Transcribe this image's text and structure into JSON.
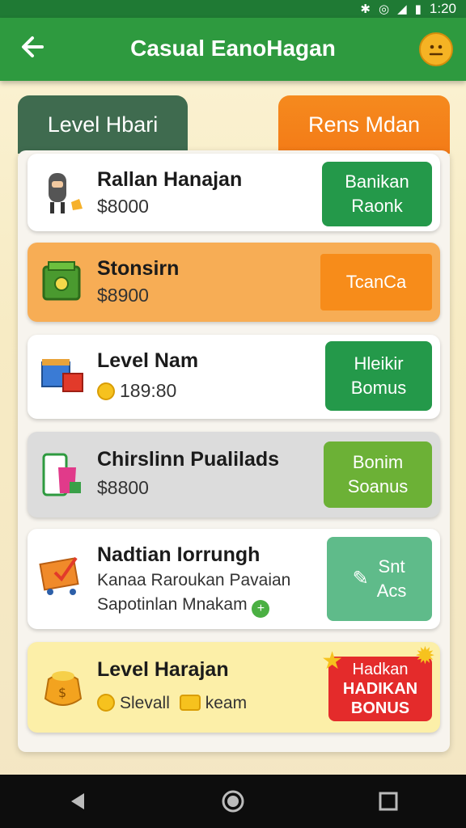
{
  "status_bar": {
    "time": "1:20",
    "icons": [
      "bluetooth-icon",
      "location-icon",
      "signal-icon",
      "battery-icon"
    ]
  },
  "app_bar": {
    "title": "Casual EanoHagan",
    "back_icon": "arrow-left-icon",
    "avatar_icon": "face-icon"
  },
  "tabs": [
    {
      "label": "Level Hbari",
      "active": true,
      "color": "#3f6b4f"
    },
    {
      "label": "Rens Mdan",
      "active": false,
      "color": "#f47b17"
    }
  ],
  "cards": [
    {
      "icon": "character-icon",
      "title": "Rallan Hanajan",
      "value": "$8000",
      "button": [
        "Banikan",
        "Raonk"
      ],
      "bg": "#ffffff",
      "button_color": "#24994a"
    },
    {
      "icon": "cash-register-icon",
      "title": "Stonsirn",
      "value": "$8900",
      "button": [
        "TcanCa"
      ],
      "bg": "#f7ad55",
      "button_color": "#f78c1a"
    },
    {
      "icon": "gift-box-icon",
      "title": "Level Nam",
      "value": "189:80",
      "button": [
        "Hleikir",
        "Bomus"
      ],
      "bg": "#ffffff",
      "button_color": "#24994a"
    },
    {
      "icon": "phone-bag-icon",
      "title": "Chirslinn Pualilads",
      "value": "$8800",
      "button": [
        "Bonim",
        "Soanus"
      ],
      "bg": "#dcdcdc",
      "button_color": "#6cb136"
    },
    {
      "icon": "task-board-icon",
      "title": "Nadtian Iorrungh",
      "sub1": "Kanaa Raroukan Pavaian",
      "sub2": "Sapotinlan Mnakam",
      "button": [
        "Snt",
        "Acs"
      ],
      "bg": "#ffffff",
      "button_color": "#5fbb8a"
    },
    {
      "icon": "money-bag-icon",
      "title": "Level Harajan",
      "value_prefix": "Slevall",
      "value_suffix": "keam",
      "button": [
        "Hadkan",
        "HADIKAN",
        "BONUS"
      ],
      "bg": "#fcefa8",
      "button_color": "#e42b2b"
    }
  ],
  "nav_bar": {
    "buttons": [
      "back-icon",
      "home-icon",
      "recents-icon"
    ]
  }
}
